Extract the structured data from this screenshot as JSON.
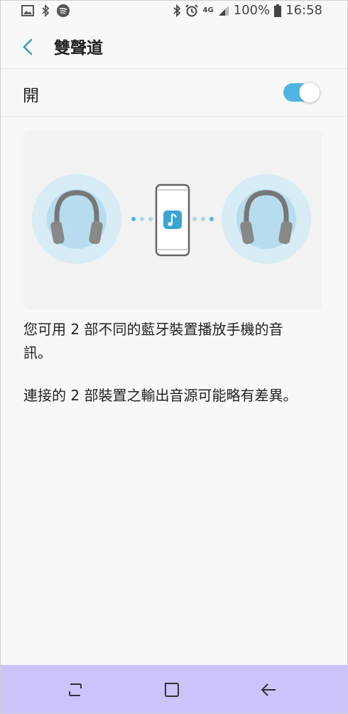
{
  "status_bar": {
    "network_label": "4G",
    "battery_percent": "100%",
    "time": "16:58",
    "left_icons": [
      "image-icon",
      "bluetooth-icon",
      "spotify-icon"
    ],
    "right_icons": [
      "bluetooth-icon",
      "alarm-icon",
      "signal-icon",
      "battery-icon"
    ]
  },
  "header": {
    "title": "雙聲道"
  },
  "toggle_row": {
    "label": "開",
    "enabled": true
  },
  "colors": {
    "accent": "#4fb6e1",
    "nav_bar": "#c9c5fa",
    "headphone": "#777777",
    "circle": "#d7ecf5"
  },
  "illustration": {
    "icons": [
      "headphones-icon",
      "phone-icon",
      "music-note-icon",
      "headphones-icon"
    ]
  },
  "description": {
    "line1": "您可用 2 部不同的藍牙裝置播放手機的音",
    "line2": "訊。",
    "line3": "連接的 2 部裝置之輸出音源可能略有差異。"
  },
  "nav_bar": {
    "buttons": [
      "recent-apps-button",
      "home-button",
      "back-button"
    ]
  }
}
